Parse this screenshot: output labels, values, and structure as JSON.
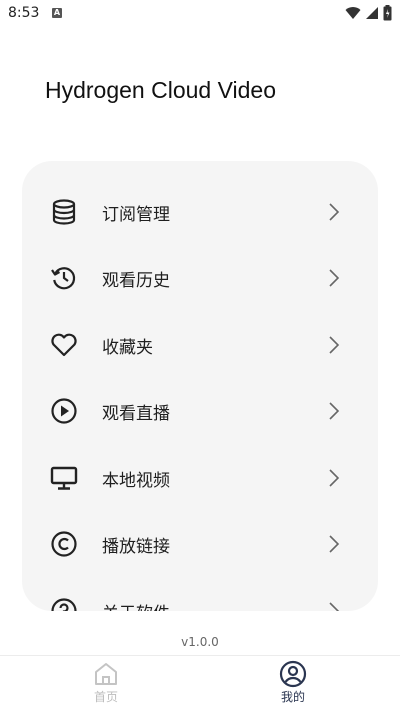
{
  "status_bar": {
    "time": "8:53",
    "notification_badge": "A"
  },
  "app": {
    "title": "Hydrogen Cloud Video"
  },
  "menu": {
    "items": [
      {
        "label": "订阅管理",
        "icon": "database-icon"
      },
      {
        "label": "观看历史",
        "icon": "history-icon"
      },
      {
        "label": "收藏夹",
        "icon": "heart-icon"
      },
      {
        "label": "观看直播",
        "icon": "play-circle-icon"
      },
      {
        "label": "本地视频",
        "icon": "monitor-icon"
      },
      {
        "label": "播放链接",
        "icon": "copyright-icon"
      },
      {
        "label": "关于软件",
        "icon": "help-icon"
      }
    ]
  },
  "footer": {
    "version": "v1.0.0"
  },
  "bottom_nav": {
    "home_label": "首页",
    "mine_label": "我的",
    "active": "mine"
  },
  "colors": {
    "active_nav": "#2a3550",
    "inactive_nav": "#bdbdbd",
    "card_bg": "#f5f5f5"
  }
}
